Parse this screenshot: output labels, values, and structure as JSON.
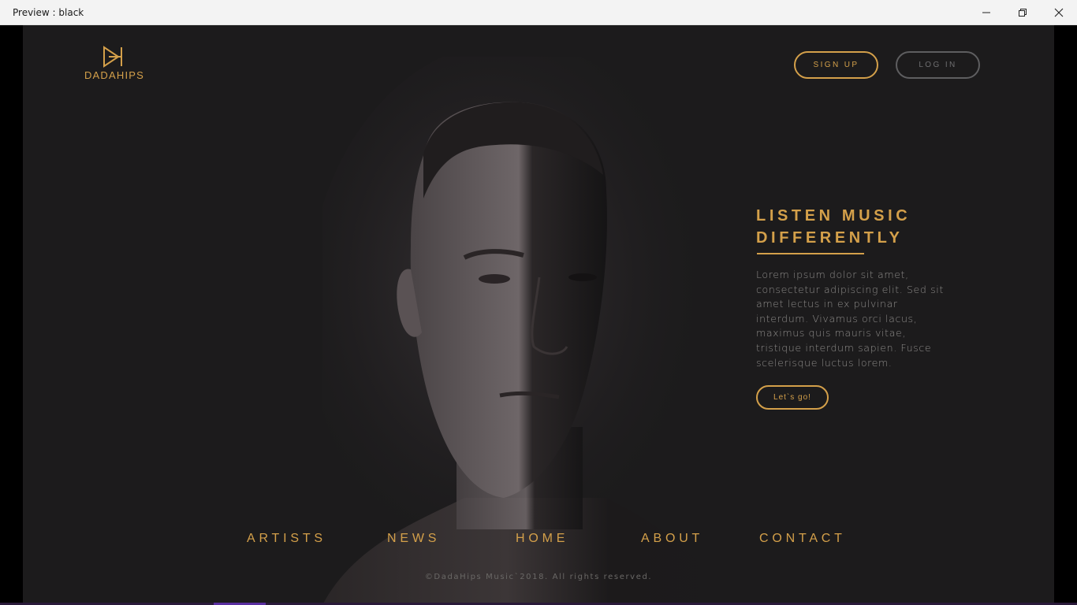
{
  "window": {
    "title": "Preview : black",
    "minimize_icon": "minimize-icon",
    "maximize_icon": "restore-icon",
    "close_icon": "close-icon"
  },
  "brand": {
    "name": "DADAHIPS",
    "logo_icon": "play-skip-logo-icon",
    "accent_color": "#d4a04a",
    "background_color": "#1c1b1c"
  },
  "auth": {
    "signup_label": "SIGN UP",
    "login_label": "LOG IN"
  },
  "hero": {
    "title_line1": "LISTEN MUSIC",
    "title_line2": "DIFFERENTLY",
    "body": "Lorem ipsum dolor sit amet, consectetur adipiscing elit. Sed sit amet lectus in ex pulvinar interdum. Vivamus orci lacus, maximus quis mauris vitae, tristique interdum sapien. Fusce scelerisque luctus lorem.",
    "cta_label": "Let`s go!"
  },
  "nav": {
    "items": [
      {
        "label": "ARTISTS"
      },
      {
        "label": "NEWS"
      },
      {
        "label": "HOME"
      },
      {
        "label": "ABOUT"
      },
      {
        "label": "CONTACT"
      }
    ]
  },
  "footer": {
    "copyright": "©DadaHips Music`2018. All rights reserved."
  }
}
